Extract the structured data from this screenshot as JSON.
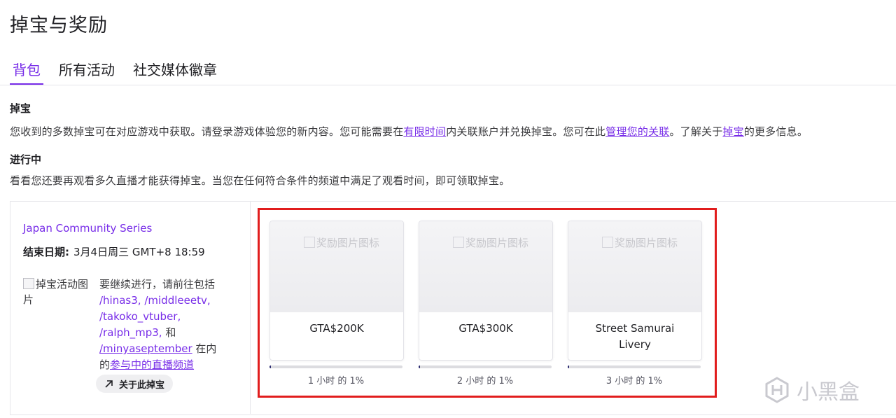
{
  "page": {
    "title": "掉宝与奖励"
  },
  "tabs": [
    {
      "label": "背包",
      "active": true
    },
    {
      "label": "所有活动",
      "active": false
    },
    {
      "label": "社交媒体徽章",
      "active": false
    }
  ],
  "drops": {
    "heading": "掉宝",
    "desc_part1": "您收到的多数掉宝可在对应游戏中获取。请登录游戏体验您的新内容。您可能需要在",
    "link_time": "有限时间",
    "desc_part2": "内关联账户并兑换掉宝。您可在此",
    "link_manage": "管理您的关联",
    "desc_part3": "。了解关于",
    "link_drops": "掉宝",
    "desc_part4": "的更多信息。"
  },
  "progress_section": {
    "heading": "进行中",
    "desc": "看看您还要再观看多久直播才能获得掉宝。当您在任何符合条件的频道中满足了观看时间，即可领取掉宝。"
  },
  "campaign": {
    "name": "Japan Community Series",
    "end_label": "结束日期:",
    "end_value": "3月4日周三 GMT+8 18:59",
    "image_alt": "掉宝活动图片",
    "instr_prefix": "要继续进行，请前往包括",
    "channels": [
      "/hinas3,",
      "/middleeetv,",
      "/takoko_vtuber,",
      "/ralph_mp3,"
    ],
    "and": " 和",
    "last_channel": "/minyaseptember",
    "instr_mid": " 在内",
    "instr_de": "的",
    "participating_link": "参与中的直播频道",
    "about_button": "关于此掉宝"
  },
  "rewards": [
    {
      "image_alt": "奖励图片图标",
      "name": "GTA$200K",
      "progress_fraction": 0.01,
      "progress_text": "1 小时 的 1%"
    },
    {
      "image_alt": "奖励图片图标",
      "name": "GTA$300K",
      "progress_fraction": 0.01,
      "progress_text": "2 小时 的 1%"
    },
    {
      "image_alt": "奖励图片图标",
      "name": "Street Samurai Livery",
      "progress_fraction": 0.01,
      "progress_text": "3 小时 的 1%"
    }
  ],
  "watermark": {
    "text": "小黑盒"
  },
  "colors": {
    "accent": "#772ce8",
    "highlight_box": "#e11d1d",
    "progress_fill": "#2b2b70"
  }
}
